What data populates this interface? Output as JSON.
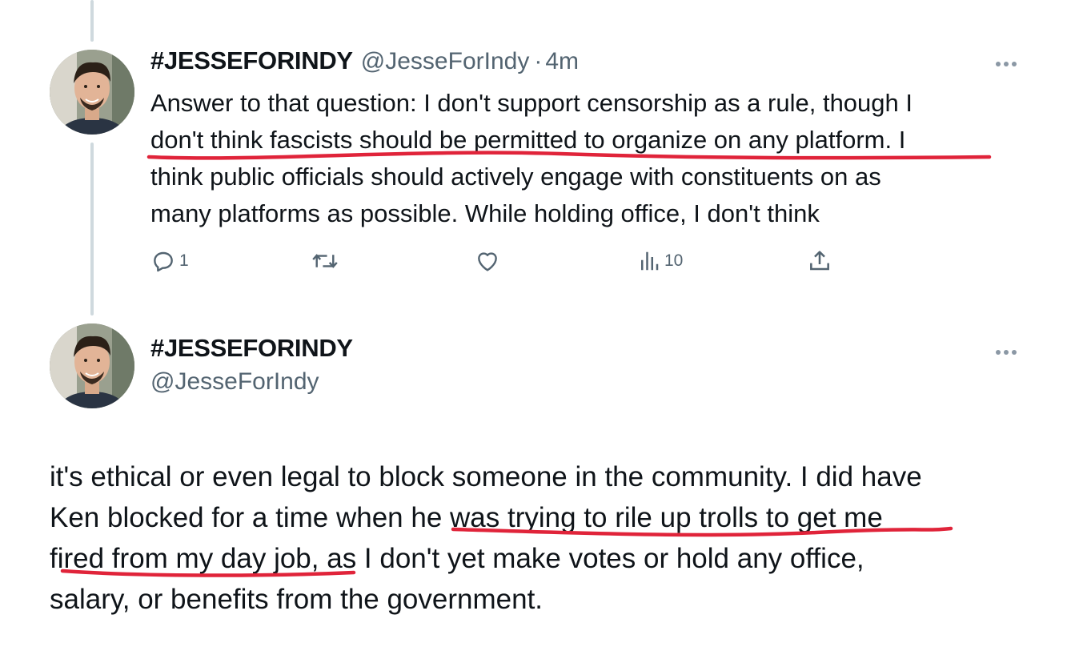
{
  "tweet1": {
    "display_name": "#JESSEFORINDY",
    "handle": "@JesseForIndy",
    "separator": "·",
    "time": "4m",
    "more_icon": "more-dots-icon",
    "text_lines": [
      "Answer to that question: I don't support censorship as a rule, though I",
      "don't think fascists should be permitted to organize on any platform. I",
      "think public officials should actively engage with constituents on as",
      "many platforms as possible. While holding office, I don't think"
    ],
    "actions": {
      "reply_icon": "reply-icon",
      "reply_count": "1",
      "retweet_icon": "retweet-icon",
      "like_icon": "heart-icon",
      "views_icon": "views-icon",
      "views_count": "10",
      "share_icon": "share-icon"
    }
  },
  "tweet2": {
    "display_name": "#JESSEFORINDY",
    "handle": "@JesseForIndy",
    "more_icon": "more-dots-icon",
    "text_lines": [
      "it's ethical or even legal to block someone in the community. I did have",
      "Ken blocked for a time when he was trying to rile up trolls to get me",
      "fired from my day job, as I don't yet make votes or hold any office,",
      "salary, or benefits from the government."
    ]
  },
  "annotation_color": "#e0243a",
  "accent_colors": {
    "thread_line": "#cfd9de",
    "muted_text": "#536471"
  }
}
